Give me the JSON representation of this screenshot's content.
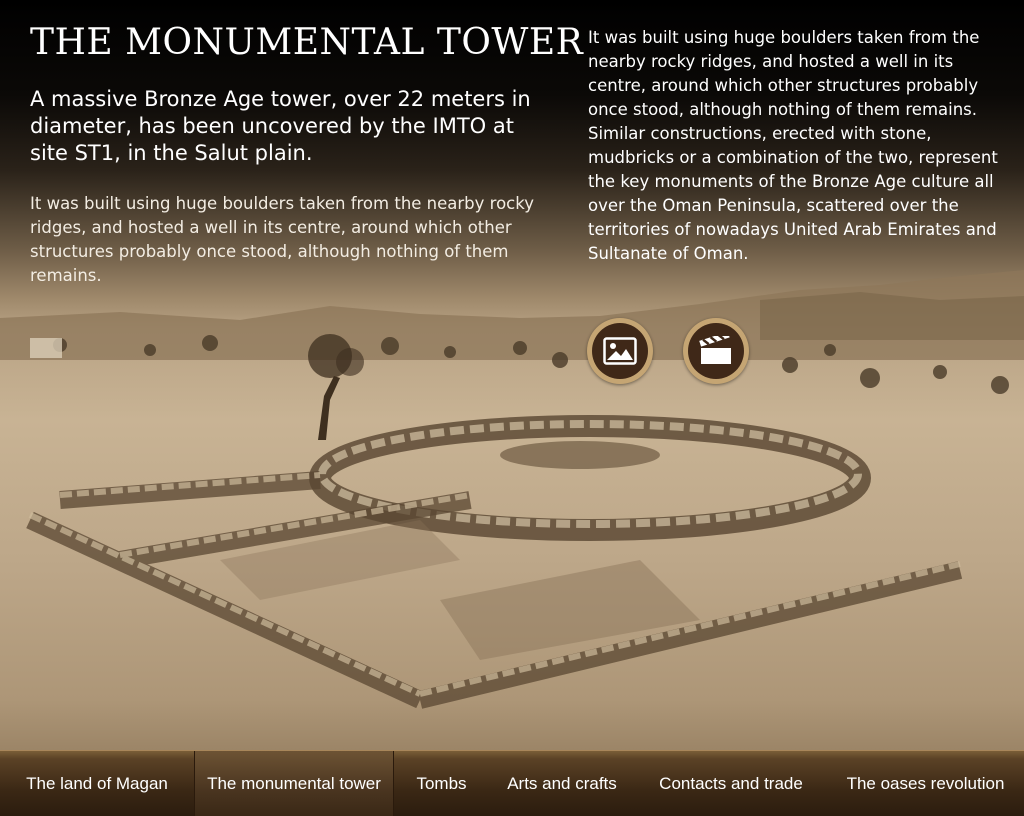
{
  "page": {
    "title": "THE MONUMENTAL TOWER",
    "lead": "A massive Bronze Age tower, over 22 meters in diameter, has been uncovered by the IMTO at site ST1, in the Salut plain.",
    "body_left": "It was built using huge boulders taken from the nearby rocky ridges, and hosted a well in its centre, around which other structures probably once stood, although nothing of them remains.",
    "body_right": "It was built using huge boulders taken from the nearby rocky ridges, and hosted a well in its centre, around which other structures probably once stood, although nothing of them remains. Similar constructions, erected with stone, mudbricks or a combination of the two, represent the key monuments of the Bronze Age culture all over the Oman Peninsula, scattered over the territories of nowadays United Arab Emirates and  Sultanate of Oman."
  },
  "media_buttons": [
    {
      "icon": "image-gallery-icon"
    },
    {
      "icon": "film-clapperboard-icon"
    }
  ],
  "nav": {
    "active": "The monumental tower",
    "items": [
      {
        "label": "The land of Magan"
      },
      {
        "label": "The monumental tower"
      },
      {
        "label": "Tombs"
      },
      {
        "label": "Arts and crafts"
      },
      {
        "label": "Contacts and trade"
      },
      {
        "label": "The oases revolution"
      }
    ]
  },
  "colors": {
    "nav_bar": "#3b2815",
    "button_ring": "#c5a573",
    "button_fill": "#3f2818",
    "text": "#ffffff"
  }
}
